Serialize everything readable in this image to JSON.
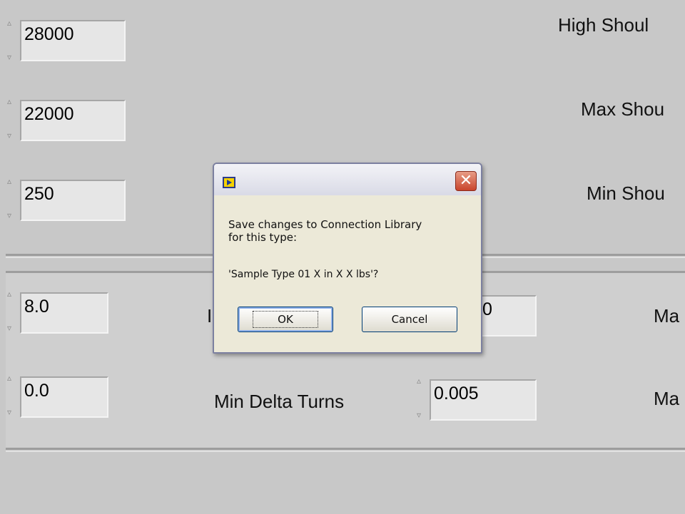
{
  "fields": {
    "high_shoulder_value": "28000",
    "max_shoulder_value": "22000",
    "min_shoulder_value": "250",
    "row4_left_value": "8.0",
    "row4_mid_value": "0",
    "row5_left_value": "0.0",
    "min_delta_turns_value": "0.005"
  },
  "labels": {
    "high_shoulder": "High Shoul",
    "max_shoulder": "Max Shou",
    "min_shoulder": "Min Shou",
    "row4_left_partial": "I",
    "row4_right": "Ma",
    "min_delta_turns": "Min Delta Turns",
    "row5_right": "Ma"
  },
  "icons": {
    "spin_up": "▵",
    "spin_down": "▿"
  },
  "dialog": {
    "close_symbol": "✕",
    "message_line1": "Save changes to Connection Library",
    "message_line2": "for this type:",
    "message_line3": "'Sample Type 01 X in X X lbs'?",
    "ok_label": "OK",
    "cancel_label": "Cancel"
  }
}
